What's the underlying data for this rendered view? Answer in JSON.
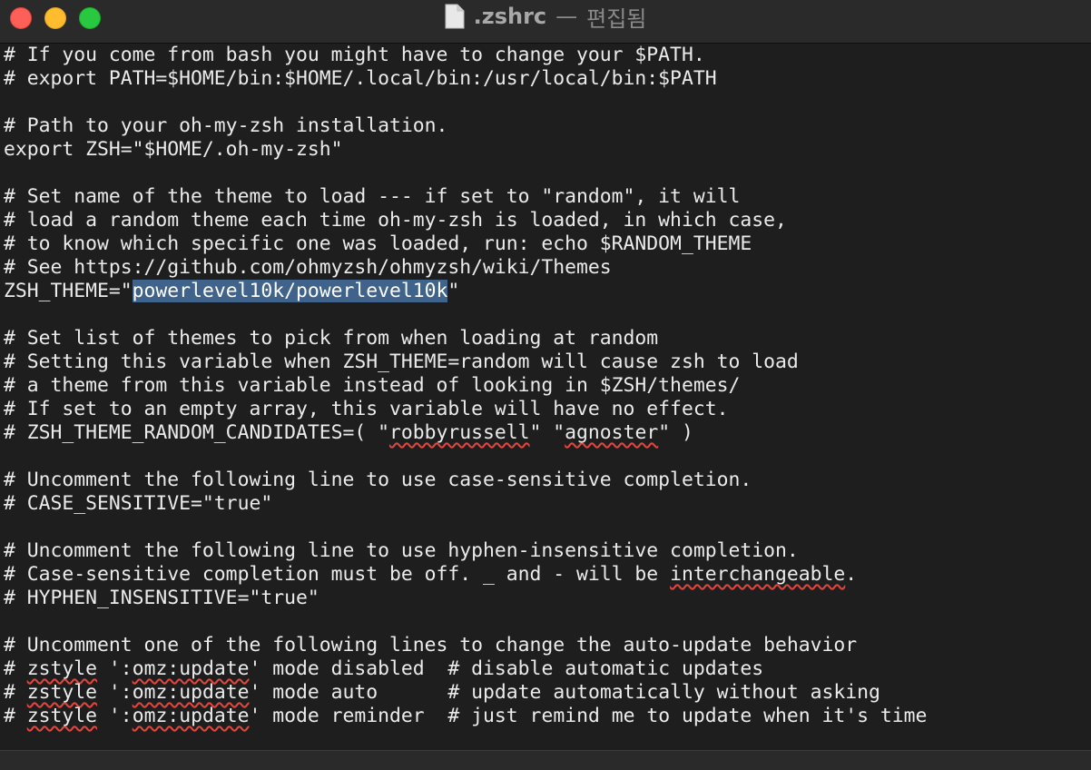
{
  "window": {
    "filename": ".zshrc",
    "separator": "—",
    "status": "편집됨",
    "colors": {
      "close": "#fe5f57",
      "minimize": "#febc2e",
      "maximize": "#28c840"
    }
  },
  "editor": {
    "selection_color": "#3f638b",
    "spellcheck_color": "#e0463d",
    "lines": [
      "# If you come from bash you might have to change your $PATH.",
      "# export PATH=$HOME/bin:$HOME/.local/bin:/usr/local/bin:$PATH",
      "",
      "# Path to your oh-my-zsh installation.",
      "export ZSH=\"$HOME/.oh-my-zsh\"",
      "",
      "# Set name of the theme to load --- if set to \"random\", it will",
      "# load a random theme each time oh-my-zsh is loaded, in which case,",
      "# to know which specific one was loaded, run: echo $RANDOM_THEME",
      "# See https://github.com/ohmyzsh/ohmyzsh/wiki/Themes",
      [
        "ZSH_THEME=\"",
        {
          "t": "powerlevel10k/powerlevel10k",
          "c": "hl"
        },
        "\""
      ],
      "",
      "# Set list of themes to pick from when loading at random",
      "# Setting this variable when ZSH_THEME=random will cause zsh to load",
      "# a theme from this variable instead of looking in $ZSH/themes/",
      "# If set to an empty array, this variable will have no effect.",
      [
        "# ZSH_THEME_RANDOM_CANDIDATES=( \"",
        {
          "t": "robbyrussell",
          "c": "sq"
        },
        "\" \"",
        {
          "t": "agnoster",
          "c": "sq"
        },
        "\" )"
      ],
      "",
      "# Uncomment the following line to use case-sensitive completion.",
      "# CASE_SENSITIVE=\"true\"",
      "",
      "# Uncomment the following line to use hyphen-insensitive completion.",
      [
        "# Case-sensitive completion must be off. _ and - will be ",
        {
          "t": "interchangeable",
          "c": "sq"
        },
        "."
      ],
      "# HYPHEN_INSENSITIVE=\"true\"",
      "",
      "# Uncomment one of the following lines to change the auto-update behavior",
      [
        "# ",
        {
          "t": "zstyle",
          "c": "sq"
        },
        " ':",
        {
          "t": "omz:update",
          "c": "sq"
        },
        "' mode disabled  # disable automatic updates"
      ],
      [
        "# ",
        {
          "t": "zstyle",
          "c": "sq"
        },
        " ':",
        {
          "t": "omz:update",
          "c": "sq"
        },
        "' mode auto      # update automatically without asking"
      ],
      [
        "# ",
        {
          "t": "zstyle",
          "c": "sq"
        },
        " ':",
        {
          "t": "omz:update",
          "c": "sq"
        },
        "' mode reminder  # just remind me to update when it's time"
      ]
    ]
  }
}
